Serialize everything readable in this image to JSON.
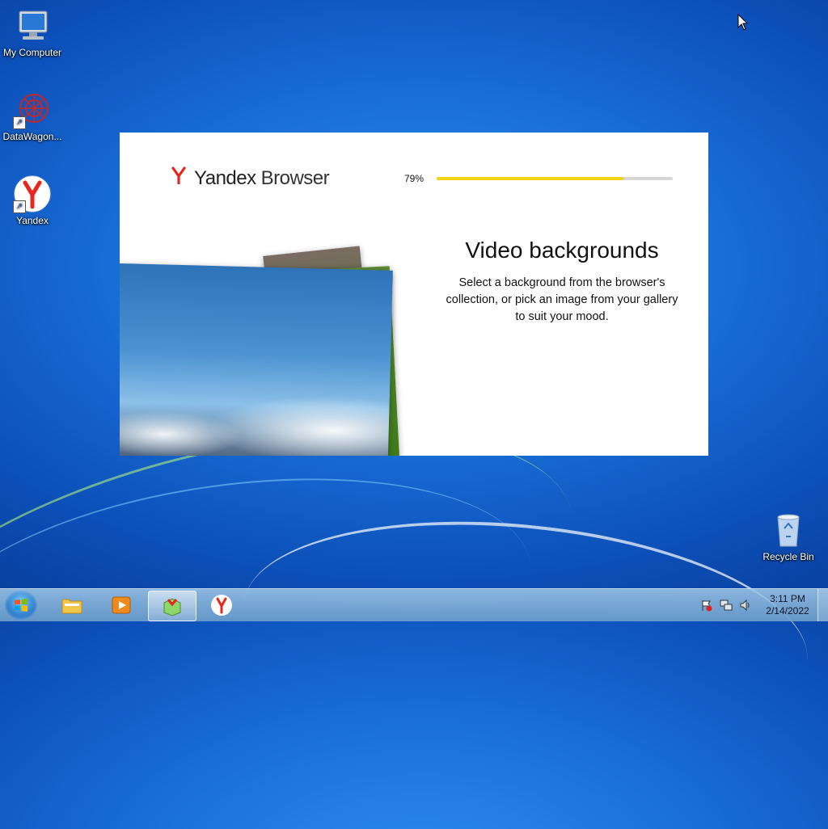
{
  "desktop": {
    "icons": [
      {
        "label": "My Computer",
        "icon": "computer-icon"
      },
      {
        "label": "DataWagon...",
        "icon": "datawagon-icon"
      },
      {
        "label": "Yandex",
        "icon": "yandex-icon"
      },
      {
        "label": "Recycle Bin",
        "icon": "recycle-bin-icon"
      }
    ]
  },
  "installer": {
    "brand_primary": "Yandex",
    "brand_secondary": "Browser",
    "brand_color": "#e6261f",
    "progress_text": "79%",
    "progress_value": 0.79,
    "progress_color": "#f2d50f",
    "headline": "Video backgrounds",
    "description": "Select a background from the browser's collection, or pick an image from your gallery to suit your mood."
  },
  "taskbar": {
    "buttons": [
      {
        "name": "explorer",
        "icon": "folder-icon"
      },
      {
        "name": "media-player",
        "icon": "media-player-icon"
      },
      {
        "name": "yandex-installer",
        "icon": "installer-icon",
        "active": true
      },
      {
        "name": "yandex-browser",
        "icon": "yandex-icon"
      }
    ],
    "tray": {
      "icons": [
        "action-center-flag-icon",
        "network-icon",
        "volume-icon"
      ],
      "time": "3:11 PM",
      "date": "2/14/2022"
    }
  }
}
